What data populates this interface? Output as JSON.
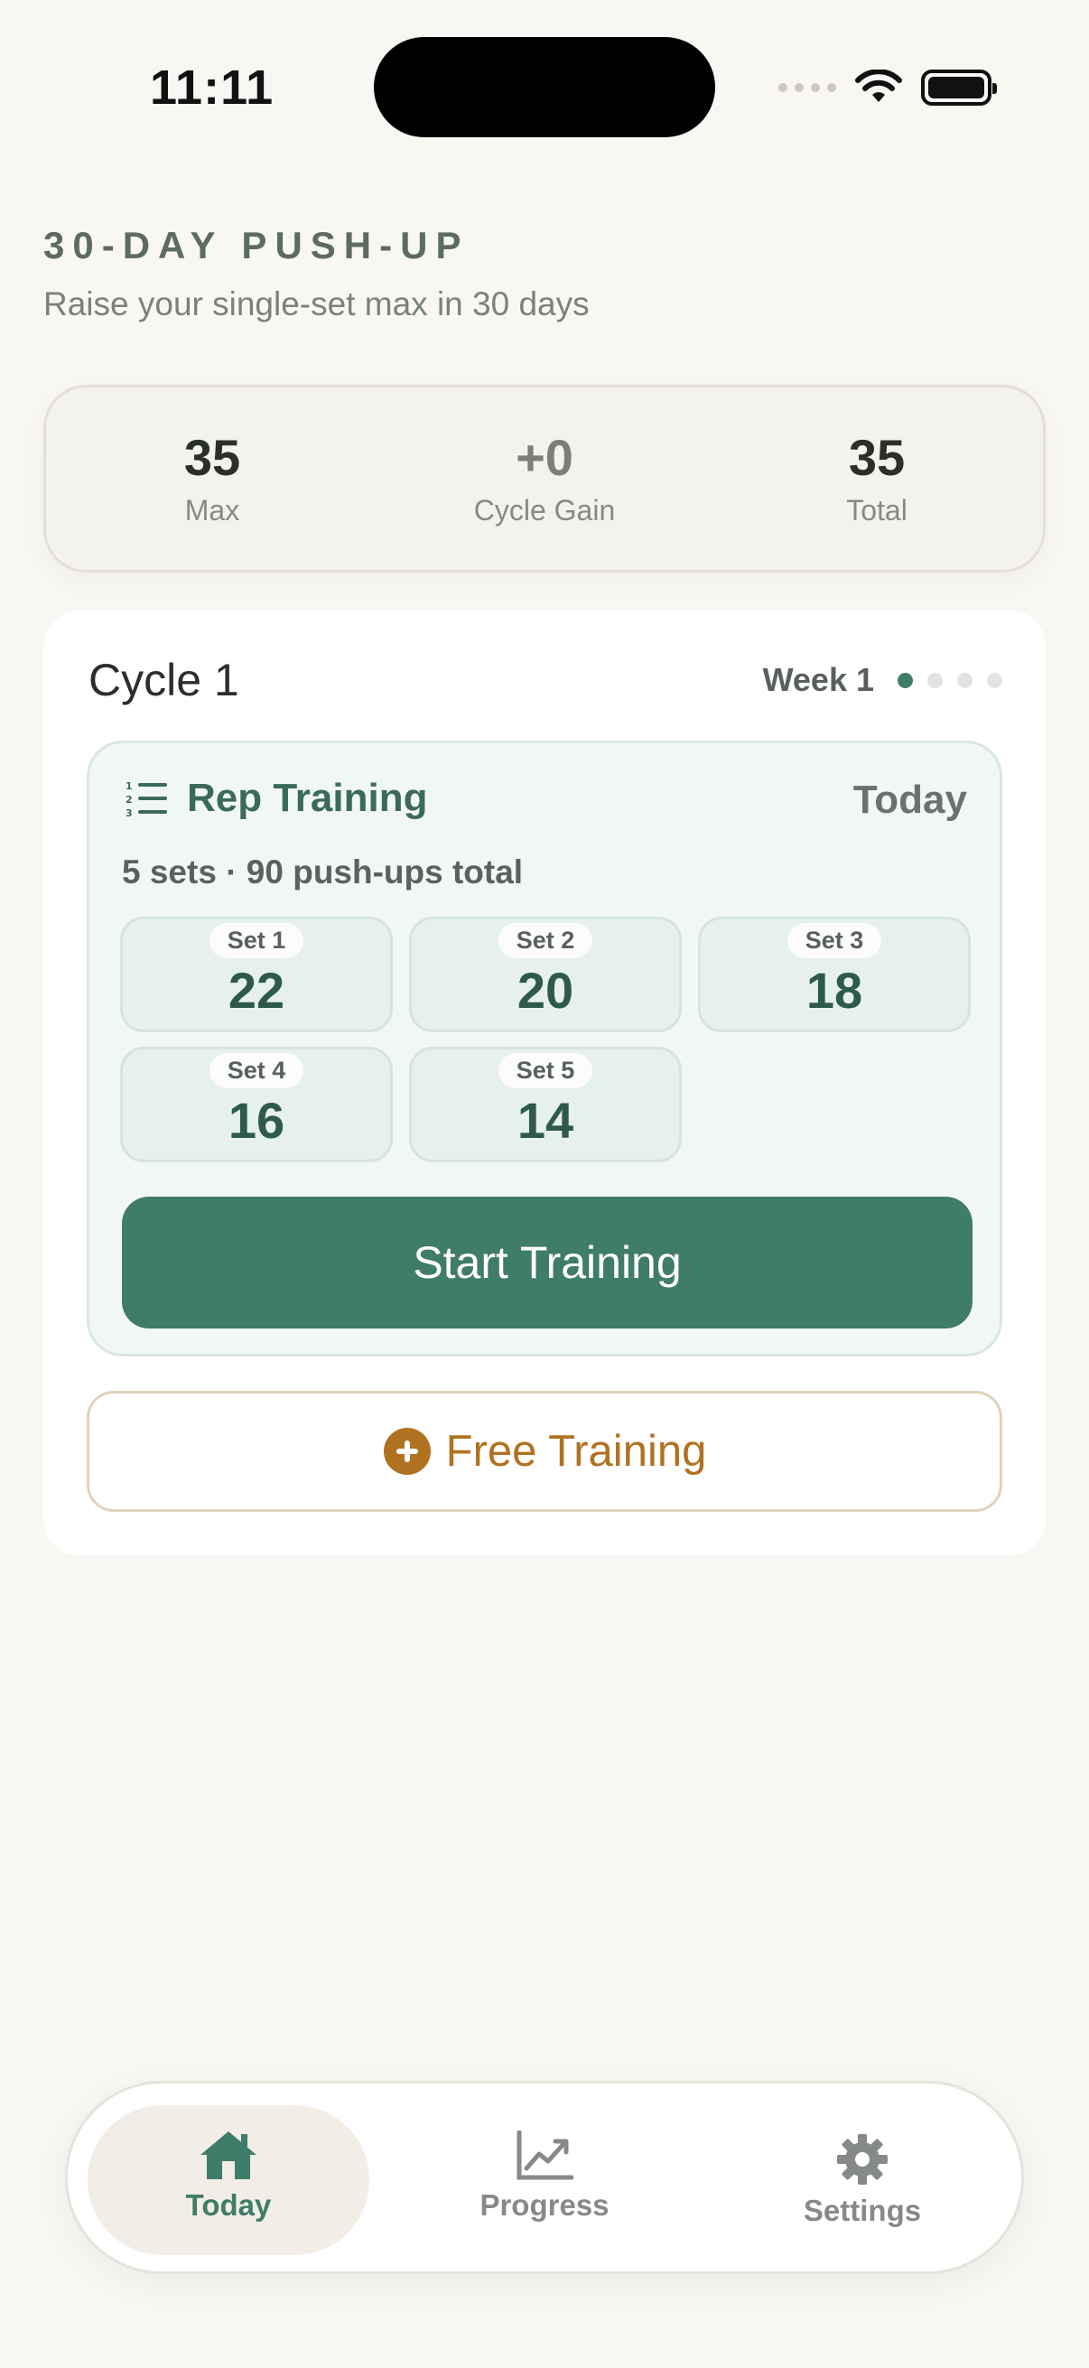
{
  "status_bar": {
    "time": "11:11",
    "icons": [
      "signal-dots-icon",
      "wifi-icon",
      "battery-icon"
    ]
  },
  "header": {
    "title": "30-DAY PUSH-UP",
    "subtitle": "Raise your single-set max in 30 days"
  },
  "stats": [
    {
      "value": "35",
      "label": "Max"
    },
    {
      "value": "+0",
      "label": "Cycle Gain"
    },
    {
      "value": "35",
      "label": "Total"
    }
  ],
  "cycle": {
    "title": "Cycle 1",
    "week_label": "Week 1",
    "weeks_total": 4,
    "week_active": 1
  },
  "training": {
    "icon": "numbered-list-icon",
    "title": "Rep Training",
    "day_label": "Today",
    "summary": "5 sets · 90 push-ups total",
    "sets": [
      {
        "label": "Set 1",
        "reps": "22"
      },
      {
        "label": "Set 2",
        "reps": "20"
      },
      {
        "label": "Set 3",
        "reps": "18"
      },
      {
        "label": "Set 4",
        "reps": "16"
      },
      {
        "label": "Set 5",
        "reps": "14"
      }
    ],
    "start_label": "Start Training"
  },
  "free_training": {
    "icon": "plus-circle-icon",
    "label": "Free Training"
  },
  "nav": {
    "today": {
      "label": "Today",
      "icon": "home-icon"
    },
    "progress": {
      "label": "Progress",
      "icon": "chart-icon"
    },
    "settings": {
      "label": "Settings",
      "icon": "gear-icon"
    }
  },
  "colors": {
    "accent": "#3f7c69",
    "free_accent": "#b07220",
    "background": "#f8f7f3"
  }
}
